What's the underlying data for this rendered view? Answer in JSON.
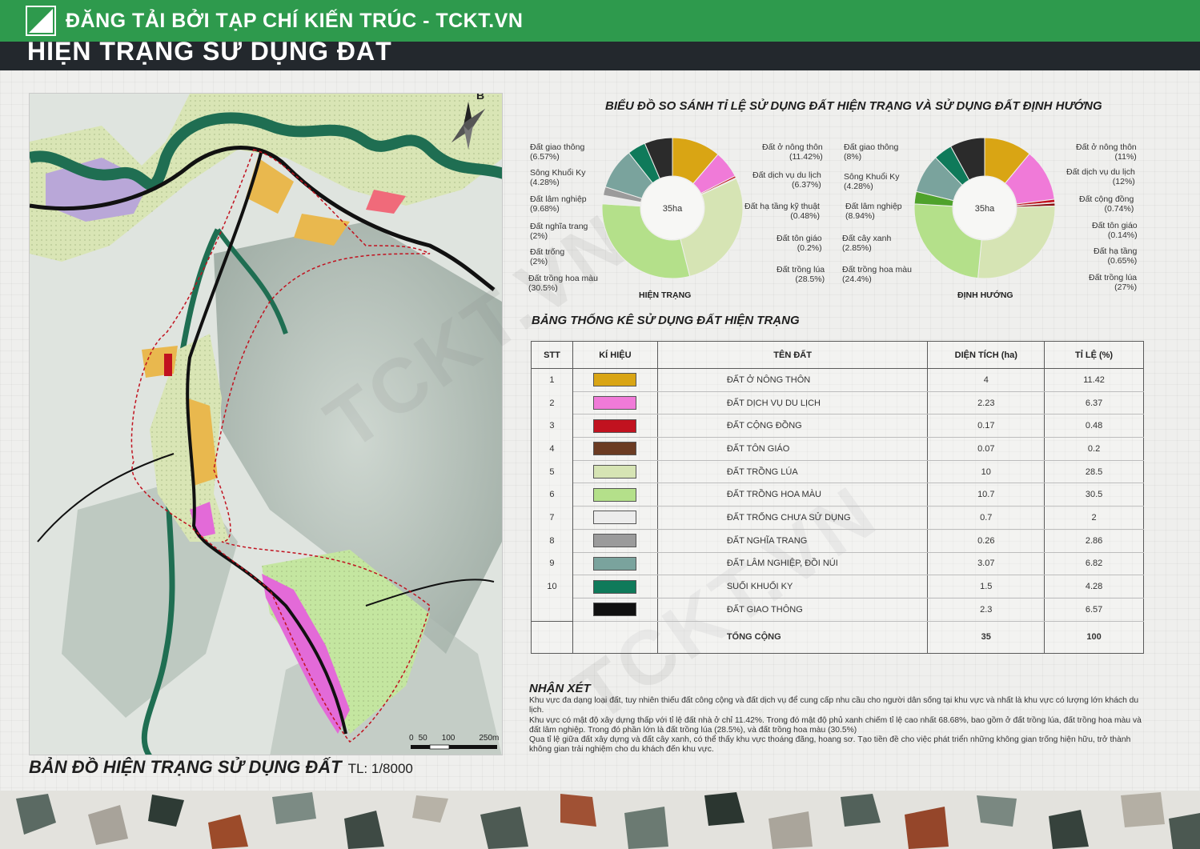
{
  "header": {
    "banner_text": "ĐĂNG TẢI BỞI TẠP CHÍ KIẾN TRÚC - TCKT.VN",
    "page_title": "HIỆN TRẠNG SỬ DỤNG ĐẤT",
    "watermark": "TCKT.VN"
  },
  "map": {
    "title": "BẢN ĐỒ HIỆN TRẠNG SỬ DỤNG ĐẤT",
    "scale": "TL: 1/8000",
    "north_label": "B",
    "scalebar_labels": [
      "0",
      "50",
      "100",
      "250m"
    ]
  },
  "colors": {
    "o_nong_thon": "#d9a514",
    "dich_vu_du_lich": "#f07ad8",
    "cong_dong": "#c1121f",
    "ton_giao": "#6b3b22",
    "trong_lua": "#d6e4b4",
    "trong_hoa_mau": "#b4e08a",
    "trong_chua_sd": "#ececec",
    "nghia_trang": "#9b9b9b",
    "lam_nghiep": "#7aa39d",
    "suoi": "#0f7a5a",
    "giao_thong": "#111111",
    "cay_xanh": "#4fa22b",
    "ha_tang": "#c1121f"
  },
  "chart_data": [
    {
      "type": "pie",
      "title": "BIỂU ĐỒ SO SÁNH TỈ LỆ SỬ DỤNG ĐẤT HIỆN TRẠNG VÀ SỬ DỤNG ĐẤT ĐỊNH HƯỚNG",
      "caption": "HIỆN TRẠNG",
      "center_label": "35ha",
      "slices": [
        {
          "label": "Đất ở nông thôn",
          "value": 11.42,
          "text": "(11.42%)",
          "color": "#d9a514"
        },
        {
          "label": "Đất dịch vụ du lịch",
          "value": 6.37,
          "text": "(6.37%)",
          "color": "#f07ad8"
        },
        {
          "label": "Đất hạ tầng kỹ thuật",
          "value": 0.48,
          "text": "(0.48%)",
          "color": "#c1121f"
        },
        {
          "label": "Đất tôn giáo",
          "value": 0.2,
          "text": "(0.2%)",
          "color": "#6b3b22"
        },
        {
          "label": "Đất trồng lúa",
          "value": 28.5,
          "text": "(28.5%)",
          "color": "#d6e4b4"
        },
        {
          "label": "Đất trồng hoa màu",
          "value": 30.5,
          "text": "(30.5%)",
          "color": "#b4e08a"
        },
        {
          "label": "Đất trống",
          "value": 2,
          "text": "(2%)",
          "color": "#ececec"
        },
        {
          "label": "Đất nghĩa trang",
          "value": 2,
          "text": "(2%)",
          "color": "#9b9b9b"
        },
        {
          "label": "Đất lâm nghiệp",
          "value": 9.68,
          "text": "(9.68%)",
          "color": "#7aa39d"
        },
        {
          "label": "Sông Khuổi Ky",
          "value": 4.28,
          "text": "(4.28%)",
          "color": "#0f7a5a"
        },
        {
          "label": "Đất giao thông",
          "value": 6.57,
          "text": "(6.57%)",
          "color": "#2b2b2b"
        }
      ]
    },
    {
      "type": "pie",
      "caption": "ĐỊNH HƯỚNG",
      "center_label": "35ha",
      "slices": [
        {
          "label": "Đất ở nông thôn",
          "value": 11,
          "text": "(11%)",
          "color": "#d9a514"
        },
        {
          "label": "Đất dịch vụ du lịch",
          "value": 12,
          "text": "(12%)",
          "color": "#f07ad8"
        },
        {
          "label": "Đất cộng đồng",
          "value": 0.74,
          "text": "(0.74%)",
          "color": "#c1121f"
        },
        {
          "label": "Đất tôn giáo",
          "value": 0.14,
          "text": "(0.14%)",
          "color": "#6b3b22"
        },
        {
          "label": "Đất hạ tầng",
          "value": 0.65,
          "text": "(0.65%)",
          "color": "#8a1010"
        },
        {
          "label": "Đất trồng lúa",
          "value": 27,
          "text": "(27%)",
          "color": "#d6e4b4"
        },
        {
          "label": "Đất trồng hoa màu",
          "value": 24.4,
          "text": "(24.4%)",
          "color": "#b4e08a"
        },
        {
          "label": "Đất cây xanh",
          "value": 2.85,
          "text": "(2.85%)",
          "color": "#4fa22b"
        },
        {
          "label": "Đất lâm nghiệp",
          "value": 8.94,
          "text": "(8.94%)",
          "color": "#7aa39d"
        },
        {
          "label": "Sông Khuổi Ky",
          "value": 4.28,
          "text": "(4.28%)",
          "color": "#0f7a5a"
        },
        {
          "label": "Đất giao thông",
          "value": 8,
          "text": "(8%)",
          "color": "#2b2b2b"
        }
      ]
    },
    {
      "type": "table",
      "title": "BẢNG THỐNG KÊ SỬ DỤNG ĐẤT HIỆN TRẠNG",
      "headers": [
        "STT",
        "KÍ HIỆU",
        "TÊN ĐẤT",
        "DIỆN TÍCH (ha)",
        "TỈ LỆ (%)"
      ],
      "rows": [
        {
          "stt": "1",
          "name": "ĐẤT Ở NÔNG THÔN",
          "area": "4",
          "pct": "11.42",
          "color": "#d9a514"
        },
        {
          "stt": "2",
          "name": "ĐẤT DỊCH VỤ DU LỊCH",
          "area": "2.23",
          "pct": "6.37",
          "color": "#f07ad8"
        },
        {
          "stt": "3",
          "name": "ĐẤT CỘNG ĐỒNG",
          "area": "0.17",
          "pct": "0.48",
          "color": "#c1121f"
        },
        {
          "stt": "4",
          "name": "ĐẤT TÔN GIÁO",
          "area": "0.07",
          "pct": "0.2",
          "color": "#6b3b22"
        },
        {
          "stt": "5",
          "name": "ĐẤT TRỒNG LÚA",
          "area": "10",
          "pct": "28.5",
          "color": "#d6e4b4"
        },
        {
          "stt": "6",
          "name": "ĐẤT TRỒNG HOA MÀU",
          "area": "10.7",
          "pct": "30.5",
          "color": "#b4e08a"
        },
        {
          "stt": "7",
          "name": "ĐẤT TRỐNG CHƯA SỬ DỤNG",
          "area": "0.7",
          "pct": "2",
          "color": "#ececec"
        },
        {
          "stt": "8",
          "name": "ĐẤT NGHĨA TRANG",
          "area": "0.26",
          "pct": "2.86",
          "color": "#9b9b9b"
        },
        {
          "stt": "9",
          "name": "ĐẤT LÂM NGHIỆP, ĐỒI NÚI",
          "area": "3.07",
          "pct": "6.82",
          "color": "#7aa39d"
        },
        {
          "stt": "10",
          "name": "SUỐI KHUỔI KY",
          "area": "1.5",
          "pct": "4.28",
          "color": "#0f7a5a"
        },
        {
          "stt": "",
          "name": "ĐẤT GIAO THÔNG",
          "area": "2.3",
          "pct": "6.57",
          "color": "#111111"
        }
      ],
      "total": {
        "label": "TỔNG CỘNG",
        "area": "35",
        "pct": "100"
      }
    }
  ],
  "notes": {
    "title": "NHẬN XÉT",
    "lines": [
      "Khu vực đa dạng loại đất, tuy nhiên thiếu đất công cộng và đất dịch vụ để cung cấp nhu cầu cho người dân sống tại khu vực và nhất là khu vực có lượng lớn khách du lịch.",
      "Khu vực có mật độ xây dựng thấp với tỉ lệ đất nhà ở chỉ 11.42%. Trong đó mật độ phủ xanh chiếm tỉ lệ cao nhất 68.68%, bao gồm ở đất trồng lúa, đất trồng hoa màu và đất lâm nghiệp. Trong đó phần lớn là đất trồng lúa (28.5%), và đất trồng hoa màu (30.5%)",
      "Qua tỉ lệ giữa đất xây dựng và đất cây xanh, có thể thấy khu vực thoáng đãng, hoang sơ. Tạo tiền đề cho việc phát triển những không gian trống hiện hữu, trở thành không gian trải nghiệm cho du khách đến khu vực."
    ]
  }
}
